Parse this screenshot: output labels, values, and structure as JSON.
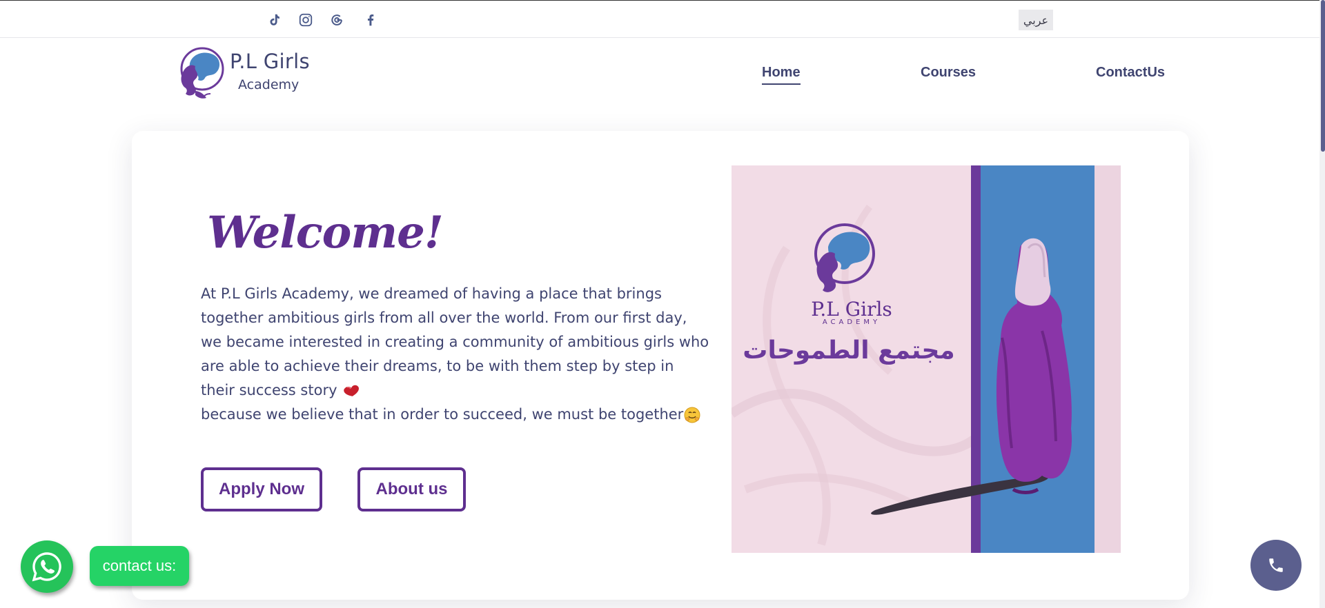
{
  "topbar": {
    "social": [
      {
        "name": "tiktok",
        "icon": "tiktok-icon"
      },
      {
        "name": "instagram",
        "icon": "instagram-icon"
      },
      {
        "name": "google",
        "icon": "google-icon"
      },
      {
        "name": "facebook",
        "icon": "facebook-icon"
      }
    ],
    "language_toggle": "عربي"
  },
  "header": {
    "brand_name": "P.L Girls",
    "brand_sub": "Academy",
    "nav": [
      {
        "label": "Home",
        "active": true
      },
      {
        "label": "Courses",
        "active": false
      },
      {
        "label": "ContactUs",
        "active": false
      }
    ]
  },
  "hero": {
    "heading": "Welcome!",
    "paragraph_1": "At P.L Girls Academy, we dreamed of having a place that brings together ambitious girls from all over the world. From our first day, we became interested in creating a community of ambitious girls who are able to achieve their dreams, to be with them step by step in their success story",
    "paragraph_2": "because we believe that in order to succeed, we must be together",
    "apply_button": "Apply Now",
    "about_button": "About us",
    "image": {
      "brand_line": "P.L Girls",
      "brand_sub": "ACADEMY",
      "arabic_title": "مجتمع الطموحات"
    }
  },
  "floating": {
    "contact_label": "contact us:",
    "whatsapp_icon": "whatsapp-icon",
    "phone_icon": "phone-icon"
  },
  "colors": {
    "accent_purple": "#5e2f8f",
    "text_navy": "#3f4470",
    "whatsapp_green": "#25d366",
    "phone_button": "#5b5f8e",
    "image_blue": "#4a86c4",
    "image_pink": "#f2dce6"
  }
}
